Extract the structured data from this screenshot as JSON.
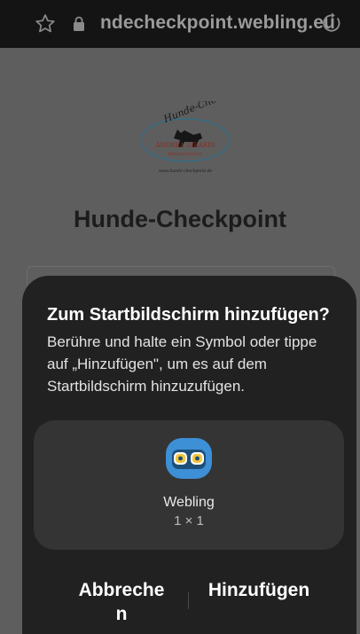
{
  "browser": {
    "url": "ndecheckpoint.webling.eu"
  },
  "page": {
    "logo_text_top": "Hunde-Checkpoint",
    "logo_text_name": "ANDREA GIRARDI",
    "logo_text_role": "Hundetrainerin",
    "logo_text_web": "www.hunde-checkpoint.de",
    "title": "Hunde-Checkpoint"
  },
  "dialog": {
    "title": "Zum Startbildschirm hinzufügen?",
    "description": "Berühre und halte ein Symbol oder tippe auf „Hinzufügen\", um es auf dem Startbildschirm hinzuzufügen.",
    "app_name": "Webling",
    "app_size": "1 × 1",
    "cancel_label": "Abbrechen",
    "add_label": "Hinzufügen"
  },
  "colors": {
    "sheet_bg": "#212121",
    "app_icon_bg": "#3d8fd6"
  }
}
